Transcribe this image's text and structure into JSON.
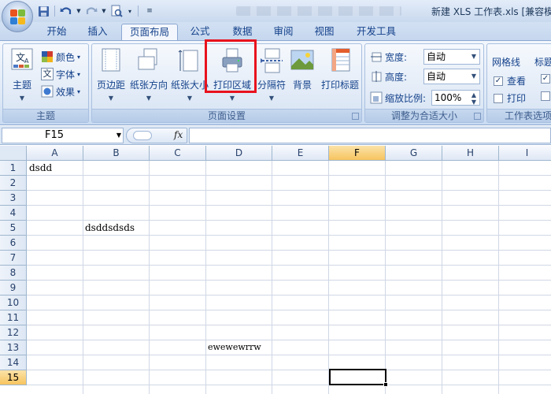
{
  "window": {
    "title": "新建 XLS 工作表.xls [兼容模"
  },
  "tabs": [
    {
      "label": "开始",
      "active": false
    },
    {
      "label": "插入",
      "active": false
    },
    {
      "label": "页面布局",
      "active": true
    },
    {
      "label": "公式",
      "active": false
    },
    {
      "label": "数据",
      "active": false
    },
    {
      "label": "审阅",
      "active": false
    },
    {
      "label": "视图",
      "active": false
    },
    {
      "label": "开发工具",
      "active": false
    }
  ],
  "ribbon": {
    "theme_group": {
      "label": "主题",
      "theme_button": "主题",
      "colors": "颜色",
      "fonts": "字体",
      "effects": "效果",
      "theme_icon_text": "文",
      "font_icon_text": "文"
    },
    "page_setup_group": {
      "label": "页面设置",
      "margins": "页边距",
      "orientation": "纸张方向",
      "size": "纸张大小",
      "print_area": "打印区域",
      "breaks": "分隔符",
      "background": "背景",
      "print_titles": "打印标题"
    },
    "scale_group": {
      "label": "调整为合适大小",
      "width_label": "宽度:",
      "width_value": "自动",
      "height_label": "高度:",
      "height_value": "自动",
      "scale_label": "缩放比例:",
      "scale_value": "100%"
    },
    "sheet_options_group": {
      "label": "工作表选项",
      "gridlines": "网格线",
      "headings_partial": "标题",
      "view": "查看",
      "print": "打印",
      "gridlines_view_checked": true,
      "gridlines_print_checked": false
    }
  },
  "formula_bar": {
    "name_box": "F15",
    "fx": "fx",
    "formula": ""
  },
  "sheet": {
    "columns": [
      "A",
      "B",
      "C",
      "D",
      "E",
      "F",
      "G",
      "H",
      "I"
    ],
    "selected_column": "F",
    "rows": [
      "1",
      "2",
      "3",
      "4",
      "5",
      "6",
      "7",
      "8",
      "9",
      "10",
      "11",
      "12",
      "13",
      "14",
      "15"
    ],
    "selected_row": "15",
    "cells": {
      "A1": "dsdd",
      "B5": "dsddsdsds",
      "D13": "ewewewrrw"
    }
  },
  "colors": {
    "accent": "#15428b",
    "highlight_box": "#e8121d",
    "selected_header": "#f7c45f"
  }
}
